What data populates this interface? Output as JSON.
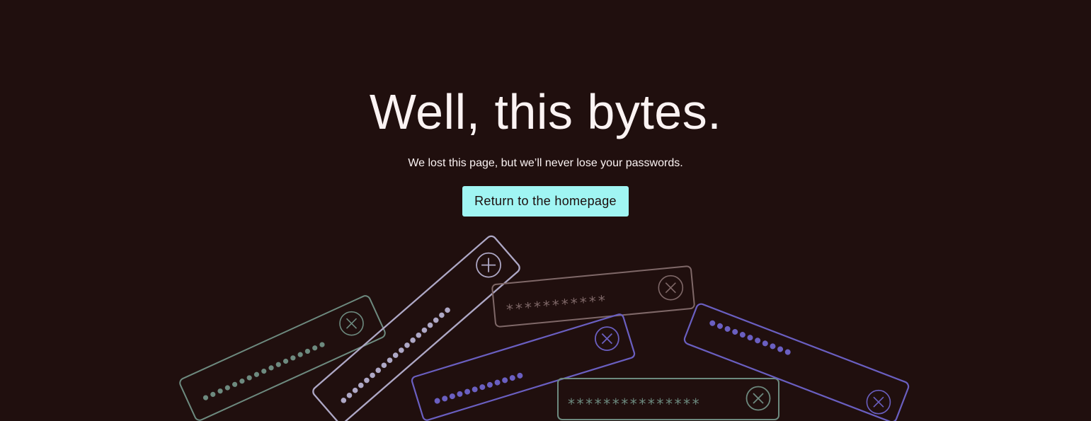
{
  "page": {
    "title": "Well, this bytes.",
    "subtitle": "We lost this page, but we’ll never lose your passwords.",
    "cta_label": "Return to the homepage"
  },
  "colors": {
    "background": "#200f0e",
    "text": "#fbf3f3",
    "cta_background": "#a0f5f3",
    "cta_text": "#1b0d0c",
    "sage": "#6d8a7f",
    "lavender": "#aea8c6",
    "violet": "#6a5fc1",
    "taupe": "#7f6868"
  },
  "password_fields": [
    {
      "style": "dots",
      "color": "sage"
    },
    {
      "style": "dots",
      "color": "lavender"
    },
    {
      "style": "asterisks",
      "color": "taupe",
      "value": "***********"
    },
    {
      "style": "dots",
      "color": "violet"
    },
    {
      "style": "asterisks",
      "color": "sage",
      "value": "***************"
    },
    {
      "style": "dots",
      "color": "violet"
    }
  ]
}
